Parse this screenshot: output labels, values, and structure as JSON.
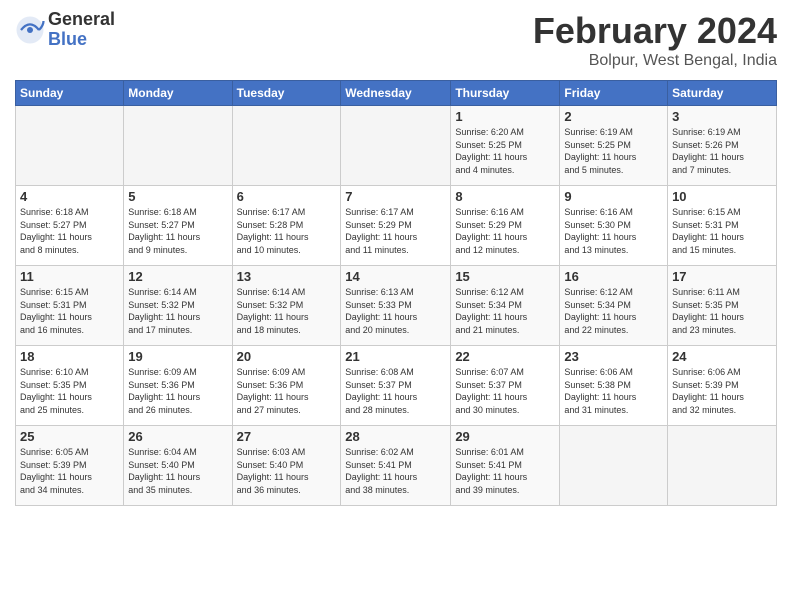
{
  "logo": {
    "text_general": "General",
    "text_blue": "Blue"
  },
  "header": {
    "title": "February 2024",
    "subtitle": "Bolpur, West Bengal, India"
  },
  "calendar": {
    "days_of_week": [
      "Sunday",
      "Monday",
      "Tuesday",
      "Wednesday",
      "Thursday",
      "Friday",
      "Saturday"
    ],
    "weeks": [
      [
        {
          "num": "",
          "info": ""
        },
        {
          "num": "",
          "info": ""
        },
        {
          "num": "",
          "info": ""
        },
        {
          "num": "",
          "info": ""
        },
        {
          "num": "1",
          "info": "Sunrise: 6:20 AM\nSunset: 5:25 PM\nDaylight: 11 hours\nand 4 minutes."
        },
        {
          "num": "2",
          "info": "Sunrise: 6:19 AM\nSunset: 5:25 PM\nDaylight: 11 hours\nand 5 minutes."
        },
        {
          "num": "3",
          "info": "Sunrise: 6:19 AM\nSunset: 5:26 PM\nDaylight: 11 hours\nand 7 minutes."
        }
      ],
      [
        {
          "num": "4",
          "info": "Sunrise: 6:18 AM\nSunset: 5:27 PM\nDaylight: 11 hours\nand 8 minutes."
        },
        {
          "num": "5",
          "info": "Sunrise: 6:18 AM\nSunset: 5:27 PM\nDaylight: 11 hours\nand 9 minutes."
        },
        {
          "num": "6",
          "info": "Sunrise: 6:17 AM\nSunset: 5:28 PM\nDaylight: 11 hours\nand 10 minutes."
        },
        {
          "num": "7",
          "info": "Sunrise: 6:17 AM\nSunset: 5:29 PM\nDaylight: 11 hours\nand 11 minutes."
        },
        {
          "num": "8",
          "info": "Sunrise: 6:16 AM\nSunset: 5:29 PM\nDaylight: 11 hours\nand 12 minutes."
        },
        {
          "num": "9",
          "info": "Sunrise: 6:16 AM\nSunset: 5:30 PM\nDaylight: 11 hours\nand 13 minutes."
        },
        {
          "num": "10",
          "info": "Sunrise: 6:15 AM\nSunset: 5:31 PM\nDaylight: 11 hours\nand 15 minutes."
        }
      ],
      [
        {
          "num": "11",
          "info": "Sunrise: 6:15 AM\nSunset: 5:31 PM\nDaylight: 11 hours\nand 16 minutes."
        },
        {
          "num": "12",
          "info": "Sunrise: 6:14 AM\nSunset: 5:32 PM\nDaylight: 11 hours\nand 17 minutes."
        },
        {
          "num": "13",
          "info": "Sunrise: 6:14 AM\nSunset: 5:32 PM\nDaylight: 11 hours\nand 18 minutes."
        },
        {
          "num": "14",
          "info": "Sunrise: 6:13 AM\nSunset: 5:33 PM\nDaylight: 11 hours\nand 20 minutes."
        },
        {
          "num": "15",
          "info": "Sunrise: 6:12 AM\nSunset: 5:34 PM\nDaylight: 11 hours\nand 21 minutes."
        },
        {
          "num": "16",
          "info": "Sunrise: 6:12 AM\nSunset: 5:34 PM\nDaylight: 11 hours\nand 22 minutes."
        },
        {
          "num": "17",
          "info": "Sunrise: 6:11 AM\nSunset: 5:35 PM\nDaylight: 11 hours\nand 23 minutes."
        }
      ],
      [
        {
          "num": "18",
          "info": "Sunrise: 6:10 AM\nSunset: 5:35 PM\nDaylight: 11 hours\nand 25 minutes."
        },
        {
          "num": "19",
          "info": "Sunrise: 6:09 AM\nSunset: 5:36 PM\nDaylight: 11 hours\nand 26 minutes."
        },
        {
          "num": "20",
          "info": "Sunrise: 6:09 AM\nSunset: 5:36 PM\nDaylight: 11 hours\nand 27 minutes."
        },
        {
          "num": "21",
          "info": "Sunrise: 6:08 AM\nSunset: 5:37 PM\nDaylight: 11 hours\nand 28 minutes."
        },
        {
          "num": "22",
          "info": "Sunrise: 6:07 AM\nSunset: 5:37 PM\nDaylight: 11 hours\nand 30 minutes."
        },
        {
          "num": "23",
          "info": "Sunrise: 6:06 AM\nSunset: 5:38 PM\nDaylight: 11 hours\nand 31 minutes."
        },
        {
          "num": "24",
          "info": "Sunrise: 6:06 AM\nSunset: 5:39 PM\nDaylight: 11 hours\nand 32 minutes."
        }
      ],
      [
        {
          "num": "25",
          "info": "Sunrise: 6:05 AM\nSunset: 5:39 PM\nDaylight: 11 hours\nand 34 minutes."
        },
        {
          "num": "26",
          "info": "Sunrise: 6:04 AM\nSunset: 5:40 PM\nDaylight: 11 hours\nand 35 minutes."
        },
        {
          "num": "27",
          "info": "Sunrise: 6:03 AM\nSunset: 5:40 PM\nDaylight: 11 hours\nand 36 minutes."
        },
        {
          "num": "28",
          "info": "Sunrise: 6:02 AM\nSunset: 5:41 PM\nDaylight: 11 hours\nand 38 minutes."
        },
        {
          "num": "29",
          "info": "Sunrise: 6:01 AM\nSunset: 5:41 PM\nDaylight: 11 hours\nand 39 minutes."
        },
        {
          "num": "",
          "info": ""
        },
        {
          "num": "",
          "info": ""
        }
      ]
    ]
  }
}
